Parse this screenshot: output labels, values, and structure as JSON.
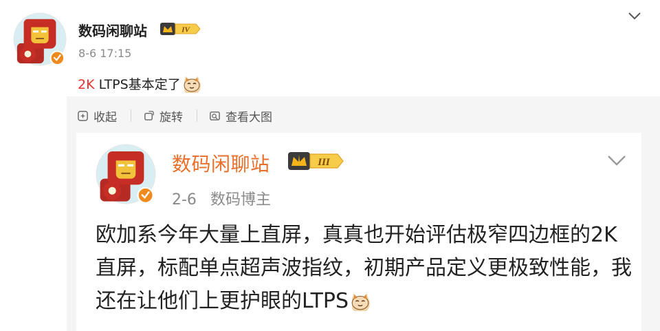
{
  "post": {
    "author": "数码闲聊站",
    "level_badge": "IV",
    "timestamp": "8-6 17:15",
    "text_highlight": "2K",
    "text_rest": " LTPS基本定了",
    "emoji": "cat-face-emoji"
  },
  "actions": {
    "collapse_label": "收起",
    "rotate_label": "旋转",
    "view_large_label": "查看大图"
  },
  "quoted_post": {
    "author": "数码闲聊站",
    "level_badge": "III",
    "date": "2-6",
    "role": "数码博主",
    "text": "欧加系今年大量上直屏，真真也开始评估极窄四边框的2K直屏，标配单点超声波指纹，初期产品定义更极致性能，我还在让他们上更护眼的LTPS",
    "emoji": "cat-face-emoji"
  },
  "colors": {
    "highlight": "#e8312a",
    "quoted_author": "#ea6f2b",
    "badge_gold": "#f4b41a",
    "verified_orange": "#f08a1e",
    "meta_gray": "#8a8a8a",
    "panel_bg": "#f5f5f5"
  }
}
